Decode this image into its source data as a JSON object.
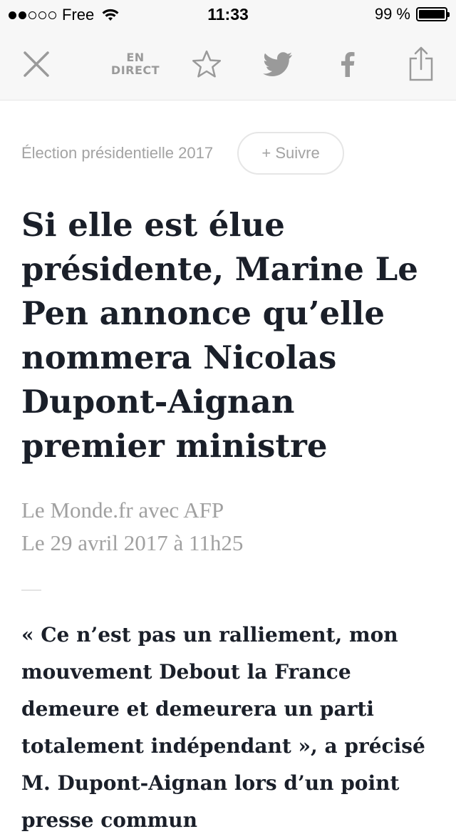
{
  "status_bar": {
    "carrier": "Free",
    "time": "11:33",
    "battery_text": "99 %",
    "signal_bars_filled": 2,
    "signal_bars_total": 5,
    "battery_level": 0.99
  },
  "toolbar": {
    "close_icon": "close-icon",
    "live_label": "EN\nDIRECT",
    "favorite_icon": "star-icon",
    "twitter_icon": "twitter-icon",
    "facebook_icon": "facebook-icon",
    "share_icon": "share-icon",
    "icon_color": "#9a9a9a"
  },
  "article": {
    "topic": "Élection présidentielle 2017",
    "follow_label": "+ Suivre",
    "headline": "Si elle est élue présidente, Marine Le Pen annonce qu’elle nommera Nicolas Dupont-Aignan premier ministre",
    "source": "Le Monde.fr avec AFP",
    "date": "Le 29 avril 2017 à 11h25",
    "lead": "« Ce n’est pas un ralliement, mon mouvement Debout la France demeure et demeurera un parti totalement indépendant », a précisé M. Dupont-Aignan lors d’un point presse commun"
  },
  "colors": {
    "headline": "#1a1f29",
    "muted": "#a3a3a3",
    "toolbar_bg": "#f7f7f7"
  }
}
